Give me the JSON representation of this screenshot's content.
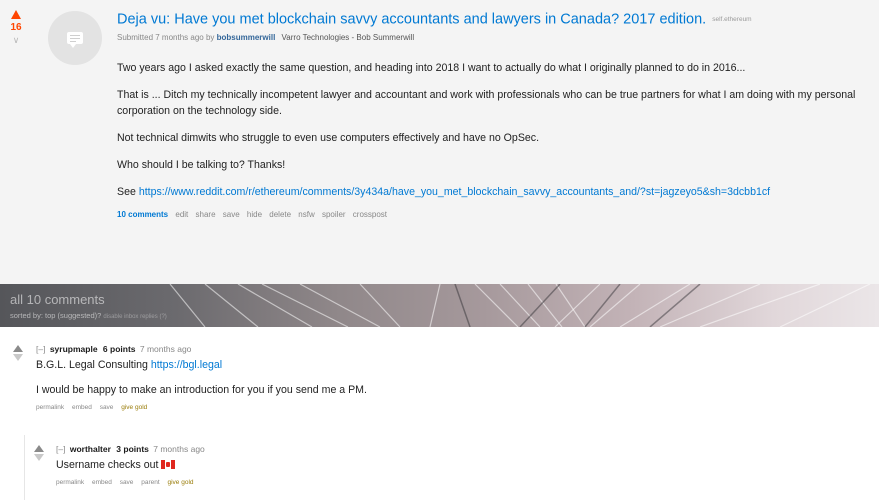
{
  "post": {
    "score": "16",
    "title": "Deja vu: Have you met blockchain savvy accountants and lawyers in Canada? 2017 edition.",
    "domain": "self.ethereum",
    "submitted": "Submitted 7 months ago by",
    "author": "bobsummerwill",
    "author_flair": "Varro Technologies - Bob Summerwill",
    "paragraphs": [
      "Two years ago I asked exactly the same question, and heading into 2018 I want to actually do what I originally planned to do in 2016...",
      "That is ... Ditch my technically incompetent lawyer and accountant and work with professionals who can be true partners for what I am doing with my personal corporation on the technology side.",
      "Not technical dimwits who struggle to even use computers effectively and have no OpSec.",
      "Who should I be talking to? Thanks!"
    ],
    "see_label": "See",
    "link": "https://www.reddit.com/r/ethereum/comments/3y434a/have_you_met_blockchain_savvy_accountants_and/?st=jagzeyo5&sh=3dcbb1cf",
    "buttons": [
      "10 comments",
      "edit",
      "share",
      "save",
      "hide",
      "delete",
      "nsfw",
      "spoiler",
      "crosspost"
    ]
  },
  "banner": {
    "title": "all 10 comments",
    "sorted_by": "sorted by: top (suggested)?",
    "extra": "disable inbox replies (?)"
  },
  "comments": [
    {
      "toggle": "[–]",
      "author": "syrupmaple",
      "points": "6 points",
      "time": "7 months ago",
      "lines": [
        {
          "prefix": "B.G.L. Legal Consulting ",
          "link": "https://bgl.legal"
        },
        {
          "prefix": "I would be happy to make an introduction for you if you send me a PM.",
          "link": ""
        }
      ],
      "buttons": [
        "permalink",
        "embed",
        "save",
        "give gold"
      ]
    },
    {
      "toggle": "[–]",
      "author": "worthalter",
      "points": "3 points",
      "time": "7 months ago",
      "body": "Username checks out",
      "buttons": [
        "permalink",
        "embed",
        "save",
        "parent",
        "give gold"
      ]
    }
  ],
  "colors": {
    "link": "#0079d3",
    "upvote": "#ff4500",
    "gold": "#9a7d0a"
  }
}
